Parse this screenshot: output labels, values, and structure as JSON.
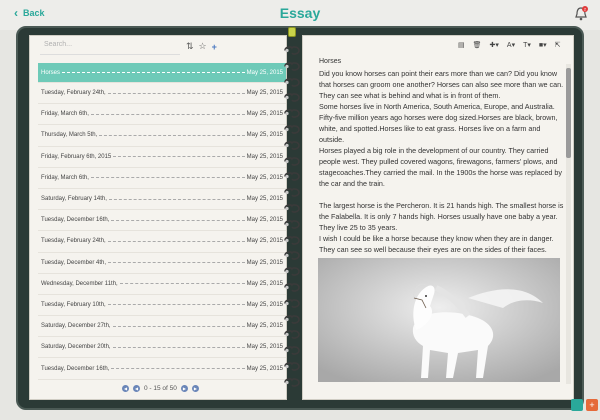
{
  "header": {
    "back_label": "Back",
    "title": "Essay",
    "notification_count": "2"
  },
  "left": {
    "search_placeholder": "Search...",
    "entries": [
      {
        "title": "Horses",
        "date": "May 25, 2015",
        "selected": true
      },
      {
        "title": "Tuesday, February 24th,",
        "date": "May 25, 2015"
      },
      {
        "title": "Friday, March 6th,",
        "date": "May 25, 2015"
      },
      {
        "title": "Thursday, March 5th,",
        "date": "May 25, 2015"
      },
      {
        "title": "Friday, February 6th, 2015",
        "date": "May 25, 2015"
      },
      {
        "title": "Friday, March 6th,",
        "date": "May 25, 2015"
      },
      {
        "title": "Saturday, February 14th,",
        "date": "May 25, 2015"
      },
      {
        "title": "Tuesday, December 16th,",
        "date": "May 25, 2015"
      },
      {
        "title": "Tuesday, February 24th,",
        "date": "May 25, 2015"
      },
      {
        "title": "Tuesday, December 4th,",
        "date": "May 25, 2015"
      },
      {
        "title": "Wednesday, December 11th,",
        "date": "May 25, 2015"
      },
      {
        "title": "Tuesday, February 10th,",
        "date": "May 25, 2015"
      },
      {
        "title": "Saturday, December 27th,",
        "date": "May 25, 2015"
      },
      {
        "title": "Saturday, December 20th,",
        "date": "May 25, 2015"
      },
      {
        "title": "Tuesday, December 16th,",
        "date": "May 25, 2015"
      }
    ],
    "pager": {
      "range": "0 - 15 of 50"
    }
  },
  "right": {
    "essay_title": "Horses",
    "paragraphs": [
      "Did you know horses can point their ears more than we can? Did you know that horses can groom one another? Horses can also see more than we can. They can see what is behind and what is in front of them.",
      "Some horses live in North America, South America, Europe, and Australia. Fifty-five million years ago horses were dog sized.Horses are black, brown, white, and spotted.Horses like to eat grass. Horses live on a farm and outside.",
      "Horses played a big role in the development of our country. They carried people west. They pulled covered wagons, firewagons, farmers' plows, and stagecoaches.They carried the mail. In the 1900s the horse was replaced by the car and the train.",
      "The largest horse is the Percheron. It is 21 hands high. The smallest horse is the Falabella. It is only 7 hands high. Horses usually have one baby a year. They live 25 to 35 years.",
      "I wish I could be like a horse because they know when they are in danger. They can see so well because their eyes are on the sides of their faces."
    ]
  },
  "colors": {
    "accent": "#2aa89a",
    "selected_row": "#6ecab8",
    "binder": "#2b3a36"
  }
}
